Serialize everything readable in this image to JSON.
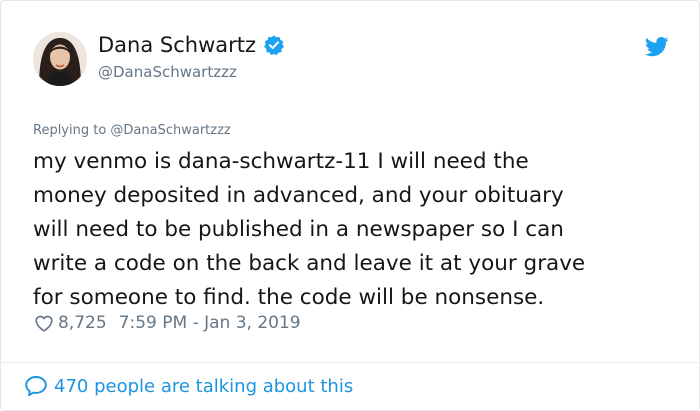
{
  "author": {
    "display_name": "Dana Schwartz",
    "handle": "@DanaSchwartzzz",
    "verified": true
  },
  "icons": {
    "brand": "twitter-bird-icon",
    "verified": "verified-badge-icon",
    "like": "heart-icon",
    "reply": "speech-bubble-icon"
  },
  "tweet": {
    "replying_to": "Replying to @DanaSchwartzzz",
    "text": "my venmo is dana-schwartz-11 I will need the\nmoney deposited in advanced, and your obituary\nwill need to be published in a newspaper so I can\nwrite a code on the back and leave it at your grave\nfor someone to find. the code will be nonsense.",
    "like_count": "8,725",
    "timestamp": "7:59 PM - Jan 3, 2019"
  },
  "footer": {
    "talking_label": "470 people are talking about this"
  },
  "colors": {
    "accent": "#1da1f2",
    "link": "#1b95e0",
    "secondary_text": "#657786",
    "primary_text": "#14171a",
    "border": "#e1e8ed"
  }
}
